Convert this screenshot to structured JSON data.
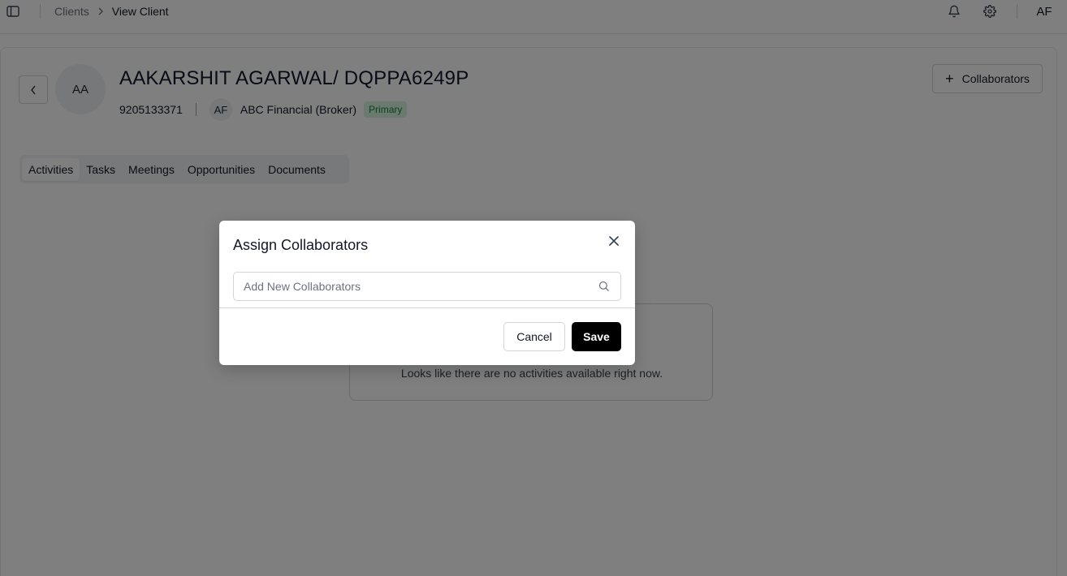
{
  "topbar": {
    "breadcrumb": {
      "parent": "Clients",
      "current": "View Client"
    },
    "icons": {
      "sidebar": "sidebar-toggle-icon",
      "notifications": "bell-icon",
      "settings": "gear-icon"
    },
    "user_initials": "AF"
  },
  "client": {
    "initials": "AA",
    "name": "AAKARSHIT AGARWAL/ DQPPA6249P",
    "phone": "9205133371",
    "broker_initials": "AF",
    "broker_name": "ABC Financial (Broker)",
    "badge": "Primary"
  },
  "actions": {
    "collaborators_label": "Collaborators"
  },
  "tabs": [
    {
      "label": "Activities",
      "active": true
    },
    {
      "label": "Tasks",
      "active": false
    },
    {
      "label": "Meetings",
      "active": false
    },
    {
      "label": "Opportunities",
      "active": false
    },
    {
      "label": "Documents",
      "active": false
    }
  ],
  "empty_state": {
    "text": "Looks like there are no activities available right now."
  },
  "modal": {
    "title": "Assign Collaborators",
    "search_placeholder": "Add New Collaborators",
    "search_value": "",
    "cancel_label": "Cancel",
    "save_label": "Save"
  },
  "colors": {
    "badge_bg": "#d6f5de",
    "badge_text": "#15803d",
    "primary_button": "#000000",
    "overlay": "rgba(0,0,0,0.5)"
  }
}
